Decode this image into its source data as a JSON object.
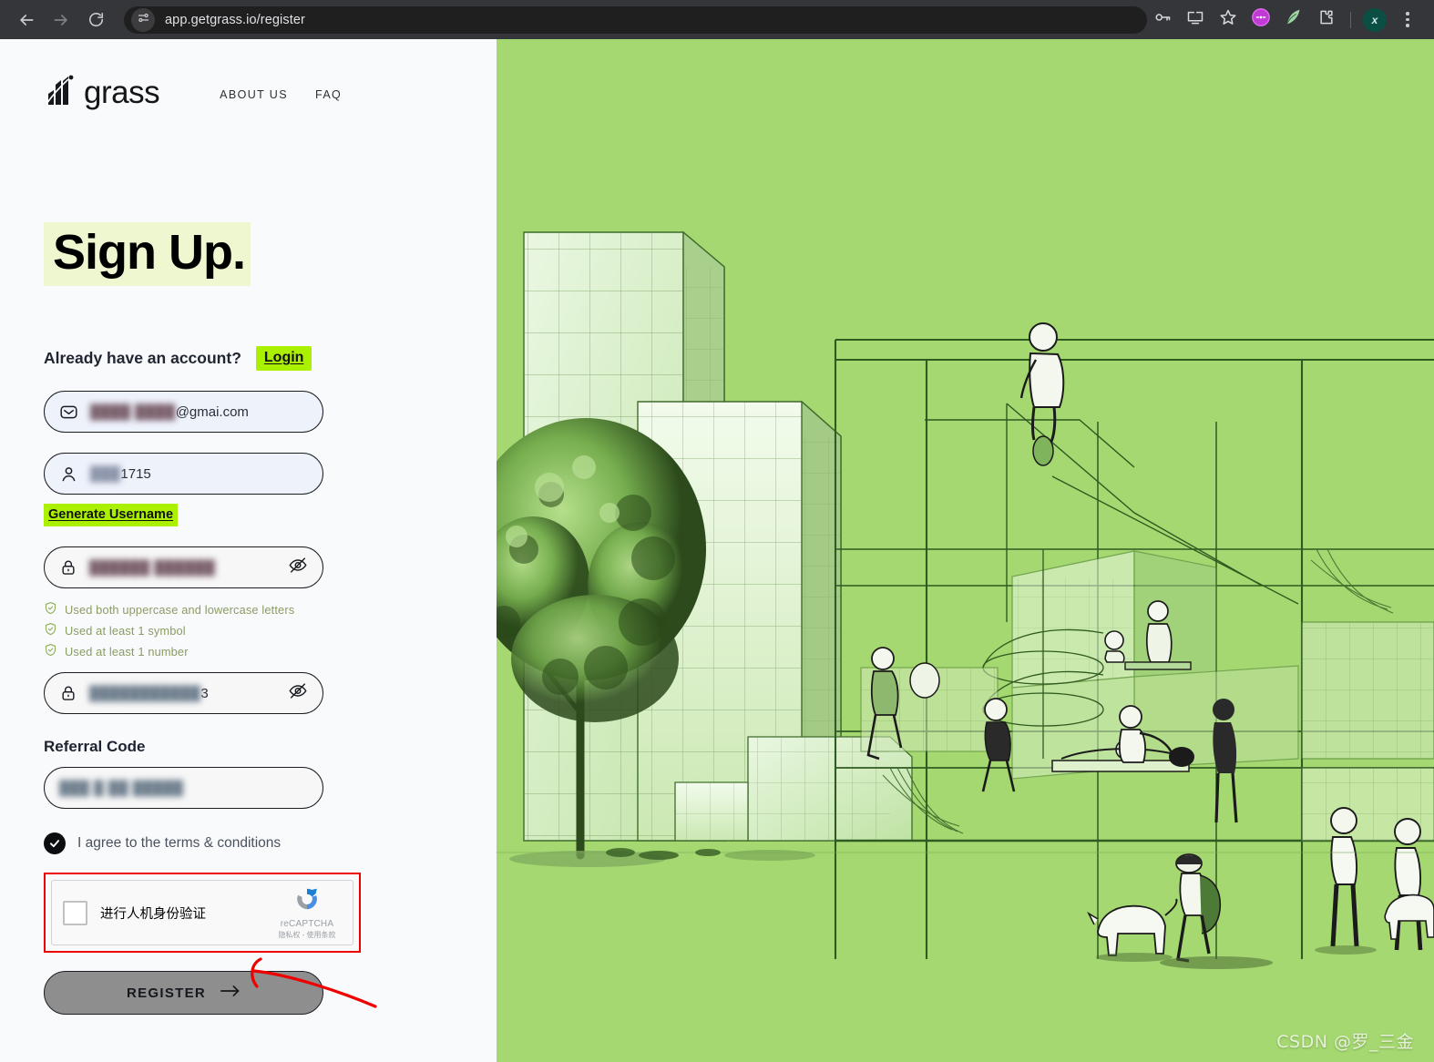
{
  "browser": {
    "url": "app.getgrass.io/register",
    "back_icon": "back-arrow-icon",
    "forward_icon": "forward-arrow-icon",
    "reload_icon": "reload-icon",
    "site_settings_icon": "page-settings-icon",
    "password_icon": "key-icon",
    "install_icon": "install-app-icon",
    "bookmark_icon": "star-icon",
    "ext1_icon": "purple-extension-icon",
    "ext2_icon": "grass-extension-icon",
    "ext3_icon": "puzzle-extensions-icon",
    "avatar_letter": "x",
    "menu_icon": "kebab-menu-icon"
  },
  "site": {
    "logo_text": "grass",
    "nav": [
      {
        "label": "ABOUT US"
      },
      {
        "label": "FAQ"
      }
    ]
  },
  "signup": {
    "title": "Sign Up.",
    "have_account_text": "Already have an account?",
    "login_label": "Login",
    "email": {
      "icon": "envelope-icon",
      "redacted": "████ ████",
      "visible_suffix": "@gmai.com"
    },
    "username": {
      "icon": "person-icon",
      "redacted": "███",
      "visible_suffix": "1715"
    },
    "generate_username_label": "Generate Username",
    "password": {
      "icon": "lock-icon",
      "redacted": "██████ ██████",
      "toggle_icon": "eye-off-icon"
    },
    "confirm_password": {
      "icon": "lock-icon",
      "redacted": "███████████",
      "visible_suffix": "3",
      "toggle_icon": "eye-off-icon"
    },
    "rules": [
      {
        "icon": "shield-check-icon",
        "label": "Used both uppercase and lowercase letters"
      },
      {
        "icon": "shield-check-icon",
        "label": "Used at least 1 symbol"
      },
      {
        "icon": "shield-check-icon",
        "label": "Used at least 1 number"
      }
    ],
    "referral_label": "Referral Code",
    "referral_value": "███ █ ██ █████",
    "terms_label": "I agree to the terms & conditions",
    "terms_checked": true,
    "captcha": {
      "label": "进行人机身份验证",
      "brand": "reCAPTCHA",
      "terms": "隐私权 - 使用条款",
      "checked": false,
      "highlight_color": "#ee0000"
    },
    "register_label": "REGISTER",
    "register_arrow_icon": "arrow-right-icon",
    "register_disabled": true
  },
  "illustration": {
    "background_color": "#a5d870",
    "alt": "Line-art illustration of a green city with a tree, glass buildings, an open multi-level structure and people"
  },
  "watermark": "CSDN @罗_三金",
  "colors": {
    "accent_green": "#aaf000",
    "title_highlight": "#eef7cf",
    "illustration_bg": "#a5d870",
    "annotation_red": "#ee0000",
    "button_disabled": "#8e8e8e",
    "rule_green": "#8a9c63"
  }
}
